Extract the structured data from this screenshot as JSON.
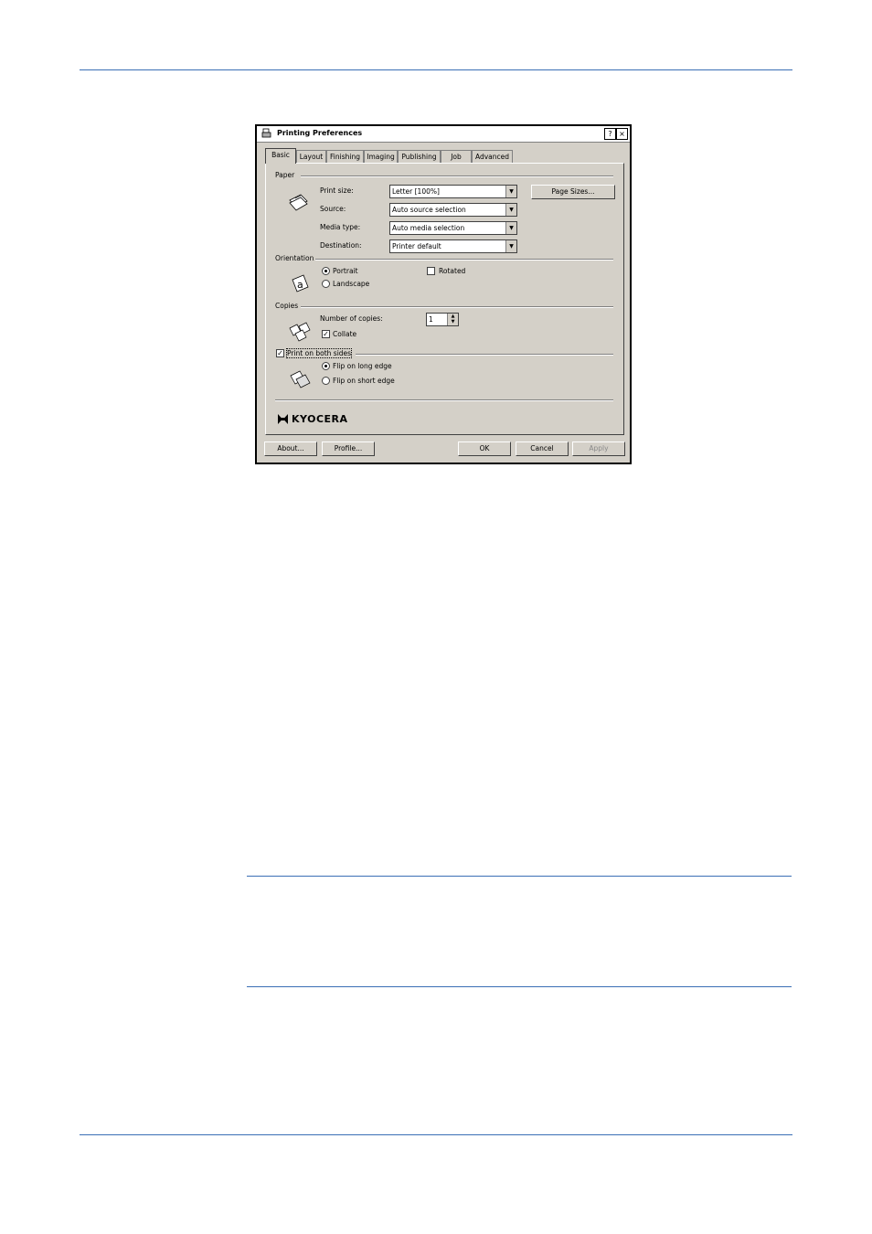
{
  "window": {
    "title": "Printing Preferences",
    "help_btn": "?",
    "close_btn": "×"
  },
  "tabs": [
    {
      "label": "Basic",
      "active": true
    },
    {
      "label": "Layout"
    },
    {
      "label": "Finishing"
    },
    {
      "label": "Imaging"
    },
    {
      "label": "Publishing"
    },
    {
      "label": "Job"
    },
    {
      "label": "Advanced"
    }
  ],
  "paper": {
    "group_label": "Paper",
    "print_size_label": "Print size:",
    "print_size_value": "Letter [100%]",
    "source_label": "Source:",
    "source_value": "Auto source selection",
    "media_type_label": "Media type:",
    "media_type_value": "Auto media selection",
    "destination_label": "Destination:",
    "destination_value": "Printer default",
    "page_sizes_button": "Page Sizes..."
  },
  "orientation": {
    "group_label": "Orientation",
    "portrait_label": "Portrait",
    "landscape_label": "Landscape",
    "rotated_label": "Rotated",
    "selected": "portrait",
    "rotated_checked": false
  },
  "copies": {
    "group_label": "Copies",
    "number_label": "Number of copies:",
    "number_value": "1",
    "collate_label": "Collate",
    "collate_checked": true
  },
  "duplex": {
    "enable_label": "Print on both sides",
    "enabled": true,
    "flip_long_label": "Flip on long edge",
    "flip_short_label": "Flip on short edge",
    "selected": "long"
  },
  "brand": {
    "logo_text": "KYOCERA"
  },
  "buttons": {
    "about": "About...",
    "profile": "Profile...",
    "ok": "OK",
    "cancel": "Cancel",
    "apply": "Apply"
  },
  "colors": {
    "dialog_bg": "#d4d0c8",
    "rule": "#3a6fb5"
  }
}
